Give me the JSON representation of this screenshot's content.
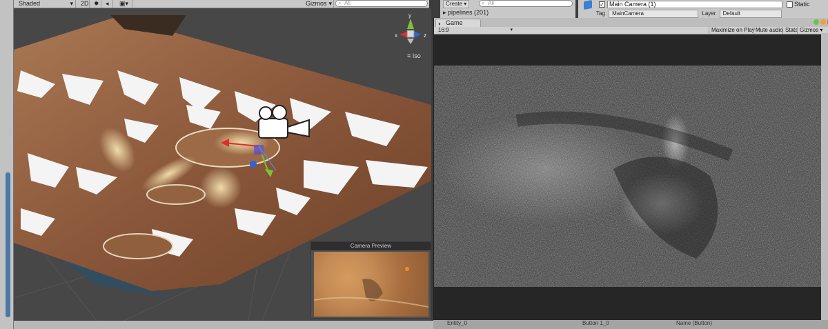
{
  "scene_toolbar": {
    "shading_mode": "Shaded",
    "mode_2d": "2D",
    "gizmos": "Gizmos",
    "search_placeholder": "All"
  },
  "scene_view": {
    "projection_label": "Iso",
    "gizmo_axes": [
      "y",
      "x",
      "z"
    ],
    "camera_preview_title": "Camera Preview"
  },
  "hierarchy": {
    "create": "Create",
    "search_placeholder": "All",
    "row": "pipelines (201)"
  },
  "inspector": {
    "object_name": "Main Camera (1)",
    "static_label": "Static",
    "tag_label": "Tag",
    "tag_value": "MainCamera",
    "layer_label": "Layer",
    "layer_value": "Default"
  },
  "game_window": {
    "tab_label": "Game",
    "aspect": "16:9",
    "buttons": {
      "maximize": "Maximize on Play",
      "mute": "Mute audio",
      "stats": "Stats",
      "gizmos": "Gizmos"
    }
  },
  "bottom_bar": {
    "left_text": "Entity_0",
    "mid_text": "Button 1_0",
    "right_text": "Name (Button)"
  },
  "colors": {
    "editor_dark": "#474747",
    "terrain_brown": "#8b5a3a",
    "snow": "#f2f2f2",
    "axis_x": "#d9302a",
    "axis_y": "#7bc334",
    "axis_z": "#2f63d8"
  }
}
